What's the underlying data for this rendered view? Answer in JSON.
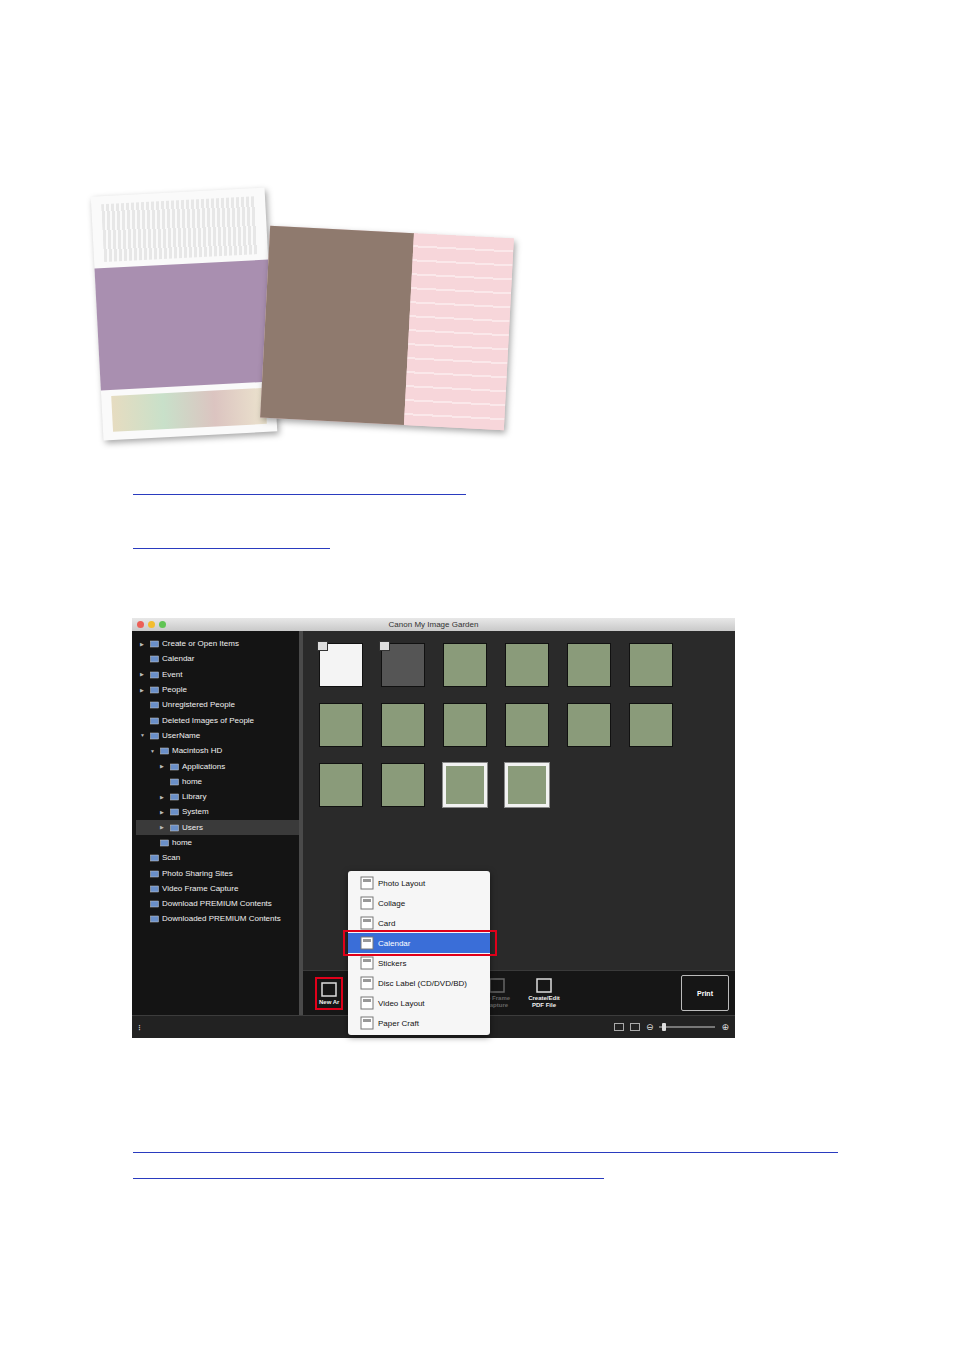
{
  "window": {
    "title": "Canon My Image Garden"
  },
  "sidebar": {
    "items": [
      {
        "label": "Create or Open Items",
        "level": 0,
        "arrow": "▶",
        "selected": false
      },
      {
        "label": "Calendar",
        "level": 0,
        "arrow": "",
        "selected": false
      },
      {
        "label": "Event",
        "level": 0,
        "arrow": "▶",
        "selected": false
      },
      {
        "label": "People",
        "level": 0,
        "arrow": "▶",
        "selected": false
      },
      {
        "label": "Unregistered People",
        "level": 0,
        "arrow": "",
        "selected": false
      },
      {
        "label": "Deleted Images of People",
        "level": 0,
        "arrow": "",
        "selected": false
      },
      {
        "label": "UserName",
        "level": 0,
        "arrow": "▼",
        "selected": false
      },
      {
        "label": "Macintosh HD",
        "level": 1,
        "arrow": "▼",
        "selected": false
      },
      {
        "label": "Applications",
        "level": 2,
        "arrow": "▶",
        "selected": false
      },
      {
        "label": "home",
        "level": 2,
        "arrow": "",
        "selected": false
      },
      {
        "label": "Library",
        "level": 2,
        "arrow": "▶",
        "selected": false
      },
      {
        "label": "System",
        "level": 2,
        "arrow": "▶",
        "selected": false
      },
      {
        "label": "Users",
        "level": 2,
        "arrow": "▶",
        "selected": true
      },
      {
        "label": "home",
        "level": 1,
        "arrow": "",
        "selected": false
      },
      {
        "label": "Scan",
        "level": 0,
        "arrow": "",
        "selected": false
      },
      {
        "label": "Photo Sharing Sites",
        "level": 0,
        "arrow": "",
        "selected": false
      },
      {
        "label": "Video Frame Capture",
        "level": 0,
        "arrow": "",
        "selected": false
      },
      {
        "label": "Download PREMIUM Contents",
        "level": 0,
        "arrow": "",
        "selected": false
      },
      {
        "label": "Downloaded PREMIUM Contents",
        "level": 0,
        "arrow": "",
        "selected": false
      }
    ]
  },
  "thumbnails": [
    {
      "kind": "document",
      "selected": false
    },
    {
      "kind": "video",
      "selected": false
    },
    {
      "kind": "photo",
      "selected": false
    },
    {
      "kind": "photo",
      "selected": false
    },
    {
      "kind": "photo",
      "selected": false
    },
    {
      "kind": "photo",
      "selected": false
    },
    {
      "kind": "photo",
      "selected": false
    },
    {
      "kind": "photo",
      "selected": false
    },
    {
      "kind": "photo",
      "selected": false
    },
    {
      "kind": "photo",
      "selected": false
    },
    {
      "kind": "photo",
      "selected": false
    },
    {
      "kind": "photo",
      "selected": false
    },
    {
      "kind": "photo",
      "selected": false
    },
    {
      "kind": "photo",
      "selected": false
    },
    {
      "kind": "photo",
      "selected": true
    },
    {
      "kind": "photo",
      "selected": true
    }
  ],
  "toolbar": {
    "buttons": [
      {
        "lines": [
          "New Ar"
        ],
        "disabled": false,
        "highlighted": true
      },
      {
        "lines": [
          "eo Frame",
          "Capture"
        ],
        "disabled": true,
        "highlighted": false
      },
      {
        "lines": [
          "Create/Edit",
          "PDF File"
        ],
        "disabled": false,
        "highlighted": false
      }
    ],
    "print": "Print"
  },
  "menu": {
    "items": [
      {
        "label": "Photo Layout",
        "selected": false
      },
      {
        "label": "Collage",
        "selected": false
      },
      {
        "label": "Card",
        "selected": false
      },
      {
        "label": "Calendar",
        "selected": true
      },
      {
        "label": "Stickers",
        "selected": false
      },
      {
        "label": "Disc Label (CD/DVD/BD)",
        "selected": false
      },
      {
        "label": "Video Layout",
        "selected": false
      },
      {
        "label": "Paper Craft",
        "selected": false
      }
    ]
  },
  "status_bar": {
    "menu_glyph": "⁝",
    "zoom_minus": "⊖",
    "zoom_plus": "⊕",
    "zoom_level": 0.05
  }
}
